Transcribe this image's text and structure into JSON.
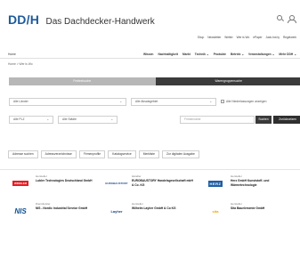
{
  "header": {
    "logo_mark": "DD/H",
    "logo_text": "Das Dachdecker-Handwerk",
    "top_nav": [
      "Shop",
      "Newsletter",
      "Wetter",
      "Wer is Wo",
      "ePaper",
      "Jack-hot.ty",
      "Regelwerk"
    ],
    "home_label": "Home",
    "main_nav": [
      "Wissen",
      "Nachhaltigkeit",
      "Markt",
      "Technik ⌄",
      "Produkte",
      "Betrieb ⌄",
      "Veranstaltungen ⌄",
      "Mehr DDH ⌄"
    ]
  },
  "breadcrumb": "Home > Wer is Wo",
  "tabs": [
    {
      "label": "Freitextsuche",
      "active": false
    },
    {
      "label": "Warengruppensuche",
      "active": true
    }
  ],
  "filters": {
    "country": "Alle Länder",
    "sales_area": "Alle Absatzgebiet",
    "branch_checkbox": "Alle Niederlassungen anzeigen",
    "plz": "Alle PLZ",
    "city": "Alle Städte",
    "company_placeholder": "Firmenname",
    "search_button": "Suchen",
    "reset_button": "Zurücksetzen"
  },
  "chips": [
    "Adresse suchen",
    "Adressverzeichnisse",
    "Firmenprofile",
    "Katalogservice",
    "Merkliste",
    "Zur digitalen Ausgabe"
  ],
  "companies": [
    {
      "category": "Hersteller",
      "name": "Lubler Technologies Deutschland GmbH",
      "logo": "WINKLER"
    },
    {
      "category": "Händler",
      "name": "EUROBAUSTORY Handelsgesellschaft mbH & Co. KG",
      "logo": "EUROBAUSTORY"
    },
    {
      "category": "Hersteller",
      "name": "Herz GmbH Kunststoff- und Wärmetechnologie",
      "logo": "HERZ"
    },
    {
      "category": "Dienstleister",
      "name": "NIS - Nordic Industrial Service GmbH",
      "logo": "NIS"
    },
    {
      "category": "Hersteller",
      "name": "Wilhelm Layher GmbH & Co KG",
      "logo": "Layher"
    },
    {
      "category": "Hersteller",
      "name": "Sita Bauelemente GmbH",
      "logo": "sita"
    }
  ],
  "colors": {
    "brand": "#1d5a9c",
    "tab_active": "#3b3b3b",
    "tab_inactive": "#b7b7b7"
  }
}
